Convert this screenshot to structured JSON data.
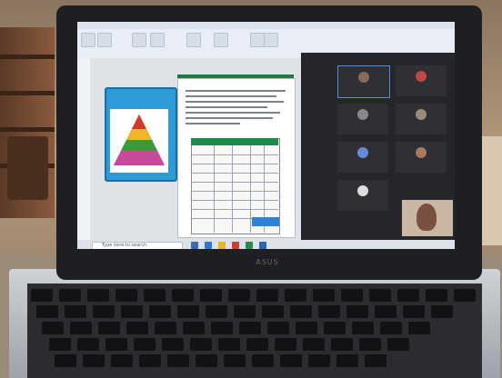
{
  "photo": {
    "description_free": true,
    "laptop_brand": "ASUS"
  },
  "screen": {
    "taskbar": {
      "search_placeholder": "Type here to search"
    },
    "video_call": {
      "participants": [
        {
          "name": ""
        },
        {
          "name": ""
        },
        {
          "name": ""
        },
        {
          "name": ""
        },
        {
          "name": ""
        },
        {
          "name": ""
        },
        {
          "name": ""
        },
        {
          "name": ""
        }
      ]
    }
  },
  "colors": {
    "accent": "#2e9bd6",
    "table_header": "#1f8a4e",
    "page_header": "#1e7a3a"
  }
}
